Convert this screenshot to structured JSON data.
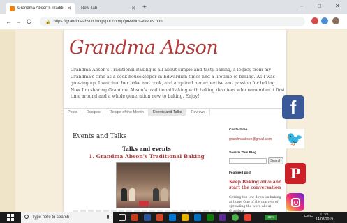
{
  "browser": {
    "tabs": [
      {
        "title": "Grandma Abson's Traditional Ba",
        "active": true
      },
      {
        "title": "New Tab",
        "active": false
      }
    ],
    "new_tab": "+",
    "window_controls": {
      "minimize": "–",
      "maximize": "□",
      "close": "✕"
    },
    "nav": {
      "back": "←",
      "forward": "→",
      "reload": "C"
    },
    "url": "https://grandmaabson.blogspot.com/p/previous-events.html"
  },
  "page": {
    "title": "Grandma Abson",
    "description": "Grandma Abson's Traditional Baking is all about simple and tasty baking, a legacy from my Grandma's time as a cook-housekeeper in Edwardian times and a lifetime of baking. As I was growing up, I watched her bake and cook, and acquired her expertise and passion for baking. Now I'm sharing Grandma Abson's traditional baking with baking devotees who remember it first time around and a whole generation new to baking. Enjoy!",
    "tabs": [
      "Posts",
      "Recipes",
      "Recipe of the Month",
      "Events and Talks",
      "Reviews"
    ],
    "selected_tab": "Events and Talks",
    "section_title": "Events and Talks",
    "post_heading": "Talks and events",
    "post_subheading": "1. Grandma Abson's Traditional Baking",
    "sidebar": {
      "contact_heading": "Contact me",
      "email": "grandmaabson@gmail.com",
      "search_heading": "Search This Blog",
      "search_placeholder": "",
      "search_button": "Search",
      "featured_heading": "Featured post",
      "featured_title": "Keep Baking alive and start the conversation",
      "featured_text": "Getting the low down on baking at home One of the marvels of spreading the word about Grandma"
    }
  },
  "social": {
    "facebook": "f",
    "twitter": "🐦",
    "pinterest": "P",
    "instagram_icon": "instagram-icon"
  },
  "taskbar": {
    "search_placeholder": "Type here to search",
    "battery": "36%",
    "lang": "ENG",
    "time": "11:21",
    "date": "14/03/2019"
  },
  "colors": {
    "title_red": "#b23a3a",
    "facebook": "#3b5998",
    "twitter": "#1da1f2",
    "pinterest": "#cb2027",
    "page_bg": "#f6eddb"
  }
}
